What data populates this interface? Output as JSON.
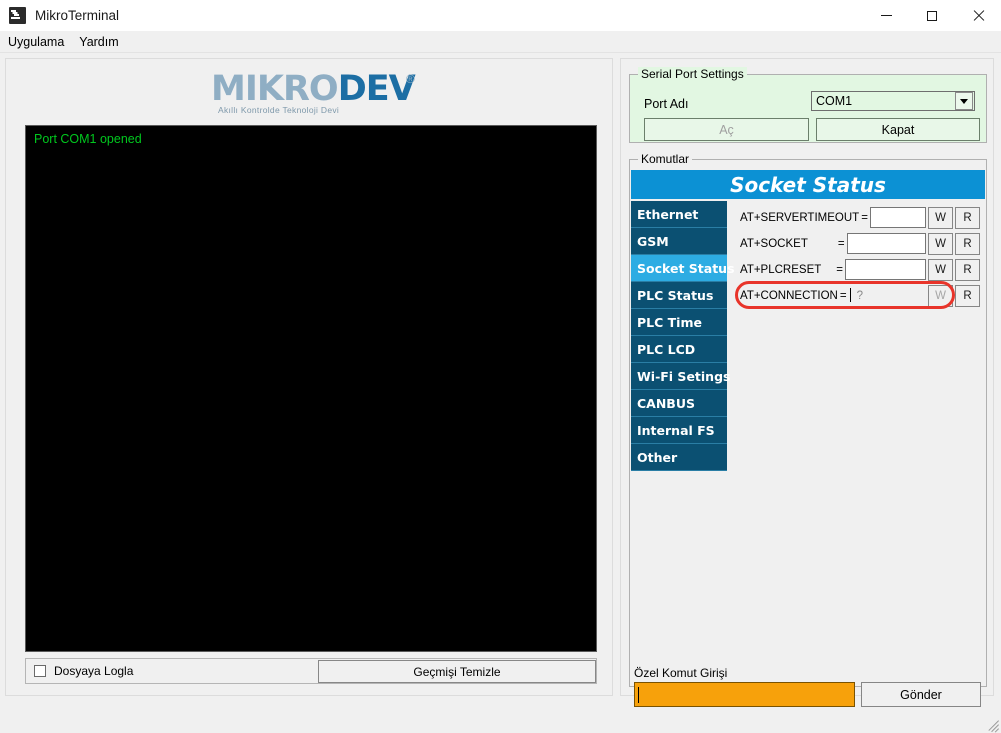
{
  "window": {
    "title": "MikroTerminal",
    "icon": "terminal-icon",
    "minimize_label": "Minimize",
    "maximize_label": "Maximize",
    "close_label": "Close"
  },
  "menu": {
    "items": [
      {
        "label": "Uygulama"
      },
      {
        "label": "Yardım"
      }
    ]
  },
  "branding": {
    "logo_part1": "MIKRO",
    "logo_part2": "DEV",
    "registered": "®",
    "tagline": "Akıllı Kontrolde Teknoloji Devi",
    "color_light": "#8faec4",
    "color_dark": "#1c6ea4"
  },
  "terminal": {
    "text": "Port COM1 opened",
    "text_color": "#00c81e",
    "background": "#000000"
  },
  "log_bar": {
    "checkbox_label": "Dosyaya Logla",
    "checkbox_checked": false,
    "clear_button": "Geçmişi Temizle"
  },
  "serial_port": {
    "group_title": "Serial Port Settings",
    "port_label": "Port Adı",
    "port_value": "COM1",
    "port_options": [
      "COM1"
    ],
    "open_button": "Aç",
    "open_disabled": true,
    "close_button": "Kapat",
    "background": "#e2f7e2"
  },
  "commands": {
    "group_title": "Komutlar",
    "header": "Socket Status",
    "header_bg": "#0c91d4",
    "tab_bg": "#0b5072",
    "tab_selected_bg": "#2dace3",
    "tabs": [
      {
        "label": "Ethernet",
        "selected": false
      },
      {
        "label": "GSM",
        "selected": false
      },
      {
        "label": "Socket Status",
        "selected": true
      },
      {
        "label": "PLC Status",
        "selected": false
      },
      {
        "label": "PLC Time",
        "selected": false
      },
      {
        "label": "PLC LCD",
        "selected": false
      },
      {
        "label": "Wi-Fi Setings",
        "selected": false
      },
      {
        "label": "CANBUS",
        "selected": false
      },
      {
        "label": "Internal FS",
        "selected": false
      },
      {
        "label": "Other",
        "selected": false
      }
    ],
    "fields": [
      {
        "label": "AT+SERVERTIMEOUT",
        "equals": "=",
        "value": "",
        "write_button": "W",
        "read_button": "R",
        "write_disabled": false,
        "highlighted": false
      },
      {
        "label": "AT+SOCKET",
        "equals": "=",
        "value": "",
        "write_button": "W",
        "read_button": "R",
        "write_disabled": false,
        "highlighted": false
      },
      {
        "label": "AT+PLCRESET",
        "equals": "=",
        "value": "",
        "write_button": "W",
        "read_button": "R",
        "write_disabled": false,
        "highlighted": false
      },
      {
        "label": "AT+CONNECTION",
        "equals": "=",
        "value": "",
        "placeholder": "?",
        "write_button": "W",
        "read_button": "R",
        "write_disabled": true,
        "highlighted": true
      }
    ],
    "highlight_color": "#e8342a"
  },
  "custom_command": {
    "label": "Özel Komut Girişi",
    "value": "",
    "input_bg": "#f7a10b",
    "send_button": "Gönder"
  }
}
